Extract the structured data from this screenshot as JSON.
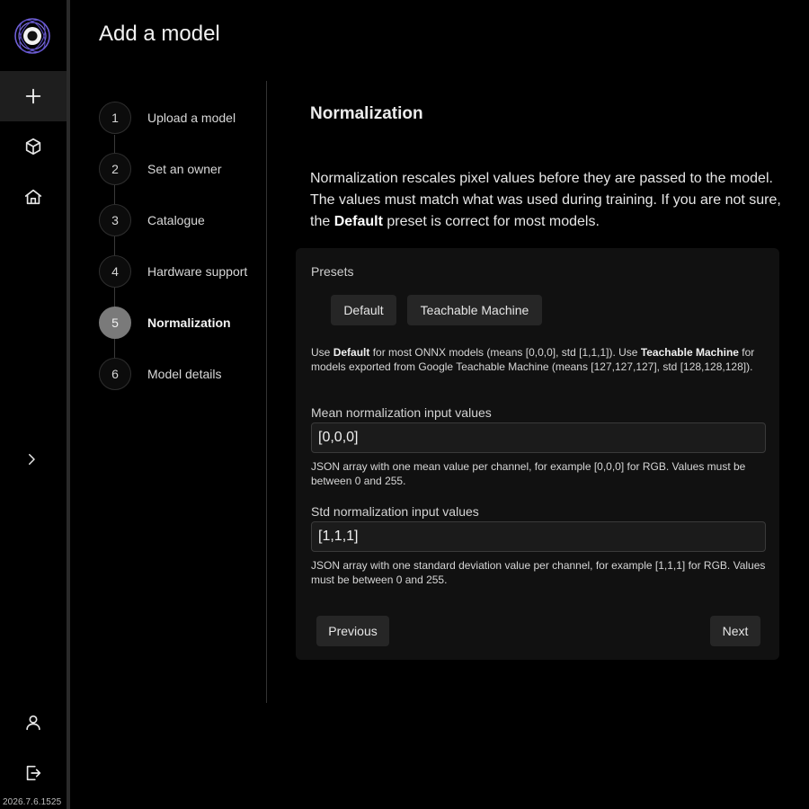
{
  "app": {
    "version": "2026.7.6.1525"
  },
  "sidebar": {
    "items": [
      {
        "name": "add",
        "icon": "plus-icon"
      },
      {
        "name": "models",
        "icon": "cube-icon"
      },
      {
        "name": "home",
        "icon": "home-icon"
      },
      {
        "name": "expand",
        "icon": "chevron-right-icon"
      },
      {
        "name": "account",
        "icon": "user-icon"
      },
      {
        "name": "logout",
        "icon": "logout-icon"
      }
    ]
  },
  "header": {
    "title": "Add a model"
  },
  "stepper": {
    "steps": [
      {
        "number": "1",
        "label": "Upload a model"
      },
      {
        "number": "2",
        "label": "Set an owner"
      },
      {
        "number": "3",
        "label": "Catalogue"
      },
      {
        "number": "4",
        "label": "Hardware support"
      },
      {
        "number": "5",
        "label": "Normalization"
      },
      {
        "number": "6",
        "label": "Model details"
      }
    ],
    "active_step": 5
  },
  "main": {
    "section_title": "Normalization",
    "intro_part1": "Normalization rescales pixel values before they are passed to the model. The values must match what was used during training. If you are not sure, the ",
    "intro_bold": "Default",
    "intro_part2": " preset is correct for most models.",
    "presets": {
      "label": "Presets",
      "default_label": "Default",
      "tm_label": "Teachable Machine",
      "help_part1": "Use ",
      "help_bold1": "Default",
      "help_part2": " for most ONNX models (means [0,0,0], std [1,1,1]). Use ",
      "help_bold2": "Teachable Machine",
      "help_part3": " for models exported from Google Teachable Machine (means [127,127,127], std [128,128,128])."
    },
    "mean": {
      "label": "Mean normalization input values",
      "value": "[0,0,0]",
      "help": "JSON array with one mean value per channel, for example [0,0,0] for RGB. Values must be between 0 and 255."
    },
    "std": {
      "label": "Std normalization input values",
      "value": "[1,1,1]",
      "help": "JSON array with one standard deviation value per channel, for example [1,1,1] for RGB. Values must be between 0 and 255."
    },
    "actions": {
      "previous_label": "Previous",
      "next_label": "Next"
    }
  },
  "colors": {
    "logo_ring": "#6f5fd6",
    "active_step": "#7a7a7a",
    "card_bg": "#111111"
  }
}
